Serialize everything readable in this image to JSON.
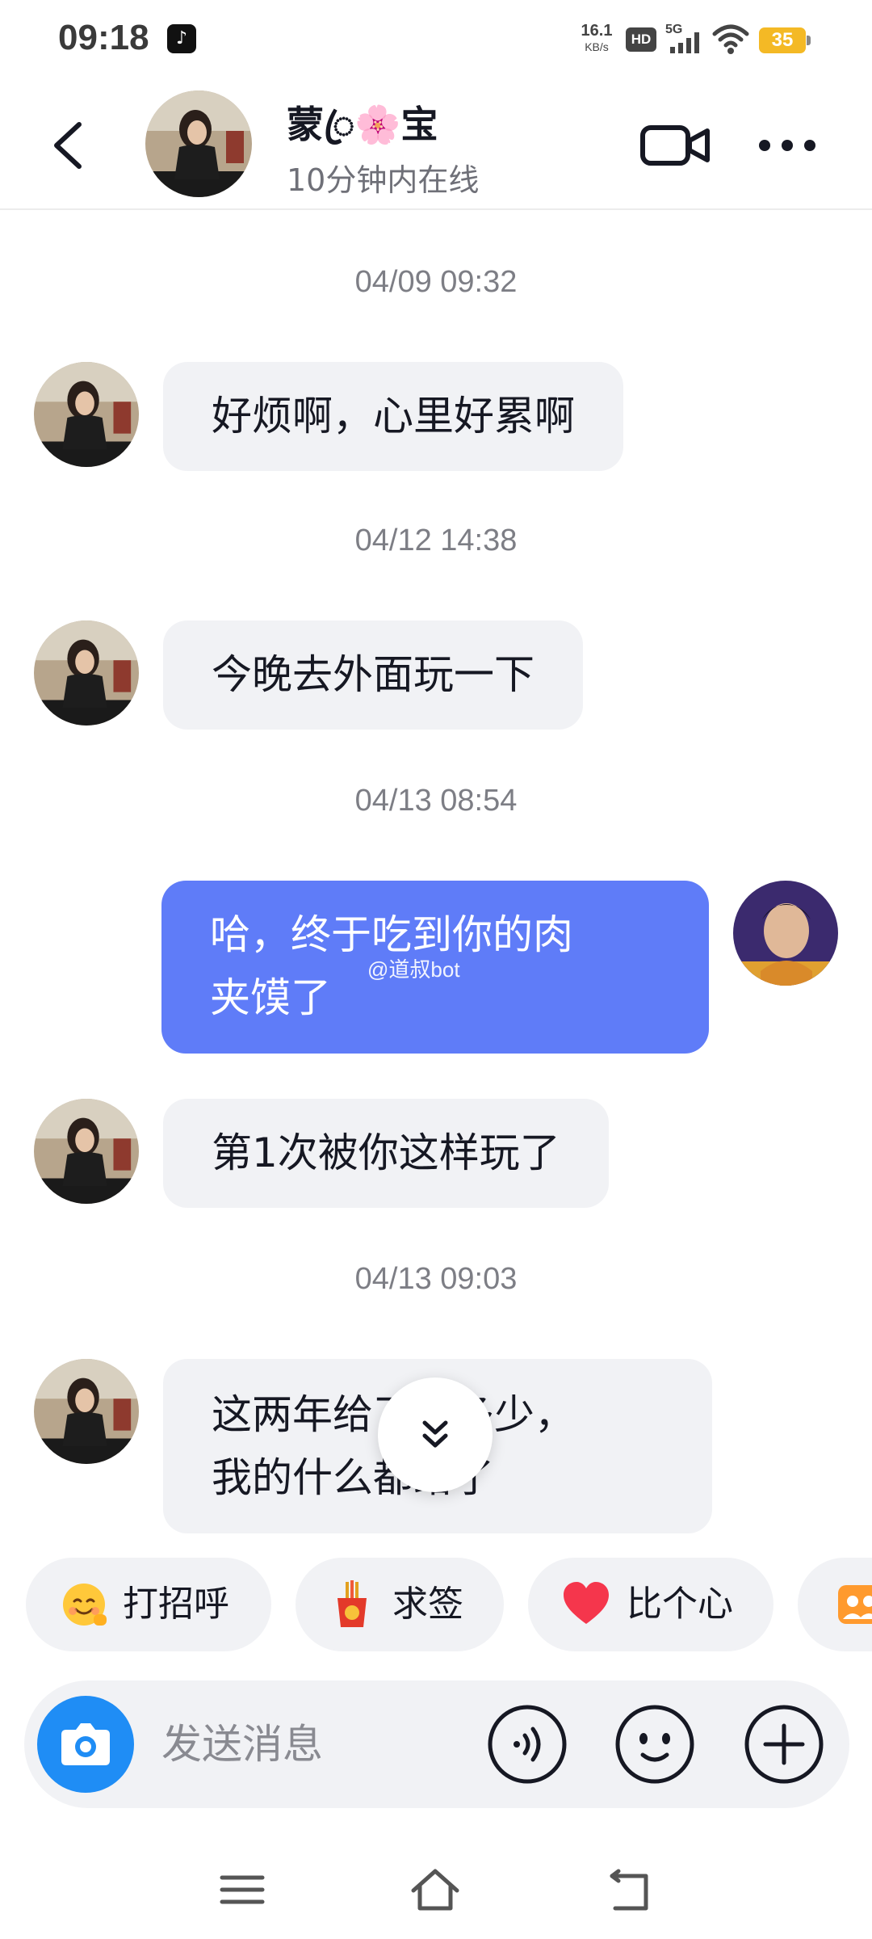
{
  "status_bar": {
    "time": "09:18",
    "app_badge_icon": "tiktok-icon",
    "net_speed_value": "16.1",
    "net_speed_unit": "KB/s",
    "hd_label": "HD",
    "network_label": "5G",
    "battery_level": "35",
    "battery_color": "#f4b925"
  },
  "header": {
    "contact_name": "蒙ꦿ🌸宝",
    "contact_status": "10分钟内在线"
  },
  "messages": [
    {
      "type": "timestamp",
      "text": "04/09 09:32"
    },
    {
      "type": "incoming",
      "text": "好烦啊，心里好累啊"
    },
    {
      "type": "timestamp",
      "text": "04/12 14:38"
    },
    {
      "type": "incoming",
      "text": "今晚去外面玩一下"
    },
    {
      "type": "timestamp",
      "text": "04/13 08:54"
    },
    {
      "type": "outgoing",
      "lines": [
        "哈，终于吃到你的肉",
        "夹馍了"
      ]
    },
    {
      "type": "incoming",
      "text": "第1次被你这样玩了"
    },
    {
      "type": "timestamp",
      "text": "04/13 09:03"
    },
    {
      "type": "incoming",
      "lines": [
        "这两年给了你多少，",
        "我的什么都给了"
      ]
    }
  ],
  "watermark": "@道叔bot",
  "quick_replies": [
    {
      "label": "打招呼",
      "icon": "smiling-face-icon"
    },
    {
      "label": "求签",
      "icon": "fortune-stick-icon"
    },
    {
      "label": "比个心",
      "icon": "heart-icon"
    },
    {
      "label": "",
      "icon": "group-photo-icon"
    }
  ],
  "input_bar": {
    "placeholder": "发送消息",
    "icons": [
      "camera-icon",
      "voice-icon",
      "emoji-icon",
      "plus-icon"
    ]
  },
  "colors": {
    "outgoing_bubble": "#5f7cf8",
    "incoming_bubble": "#f1f2f5",
    "camera_button": "#1f8df5",
    "heart": "#f5364c"
  }
}
